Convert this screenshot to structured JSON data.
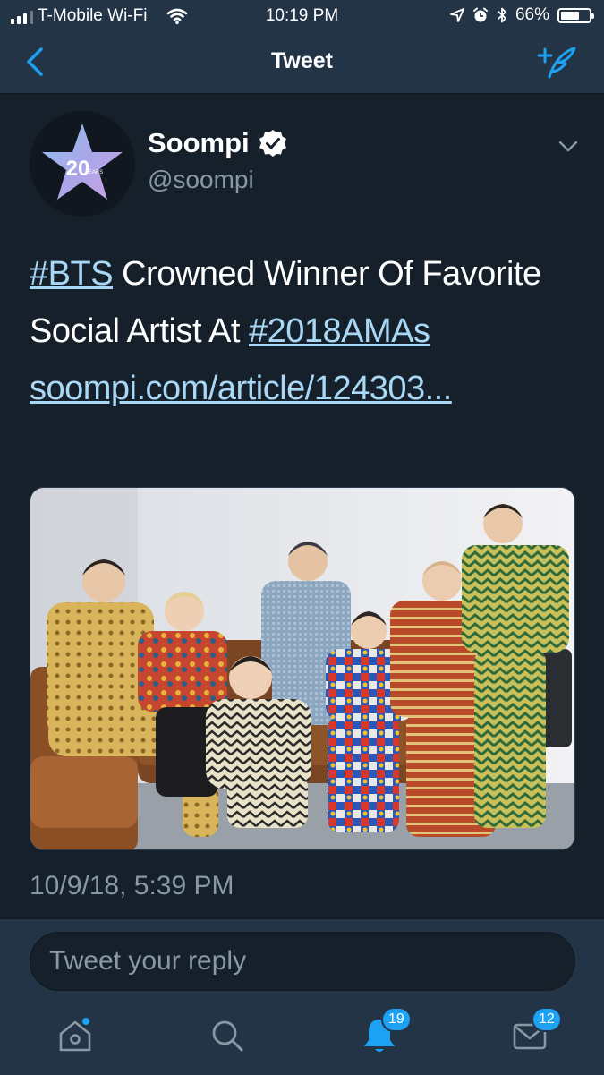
{
  "status_bar": {
    "carrier": "T-Mobile Wi-Fi",
    "time": "10:19 PM",
    "battery_percent": "66%",
    "battery_level": 0.66,
    "icons": [
      "signal-icon",
      "wifi-icon",
      "location-icon",
      "alarm-icon",
      "bluetooth-icon",
      "battery-icon"
    ]
  },
  "nav": {
    "title": "Tweet",
    "back_icon": "chevron-left-icon",
    "compose_icon": "compose-tweet-icon"
  },
  "tweet": {
    "display_name": "Soompi",
    "handle": "@soompi",
    "verified": true,
    "avatar_text": "20",
    "avatar_subtext": "YEARS",
    "text_parts": {
      "hashtag_1": "#BTS",
      "text_1": " Crowned Winner Of Favorite Social Artist At ",
      "hashtag_2": "#2018AMAs",
      "link": "soompi.com/article/124303..."
    },
    "media_alt": "Photo of seven men in patterned suits posing on a leather sofa",
    "timestamp": "10/9/18, 5:39 PM"
  },
  "reply": {
    "placeholder": "Tweet your reply"
  },
  "tab_bar": {
    "items": [
      {
        "name": "home",
        "icon": "home-icon"
      },
      {
        "name": "search",
        "icon": "search-icon"
      },
      {
        "name": "notifications",
        "icon": "bell-icon",
        "badge": "19"
      },
      {
        "name": "messages",
        "icon": "envelope-icon",
        "badge": "12"
      }
    ]
  },
  "colors": {
    "background": "#15202b",
    "header": "#243447",
    "accent": "#1da1f2",
    "link": "#a8d8f5",
    "secondary_text": "#8899a6"
  }
}
